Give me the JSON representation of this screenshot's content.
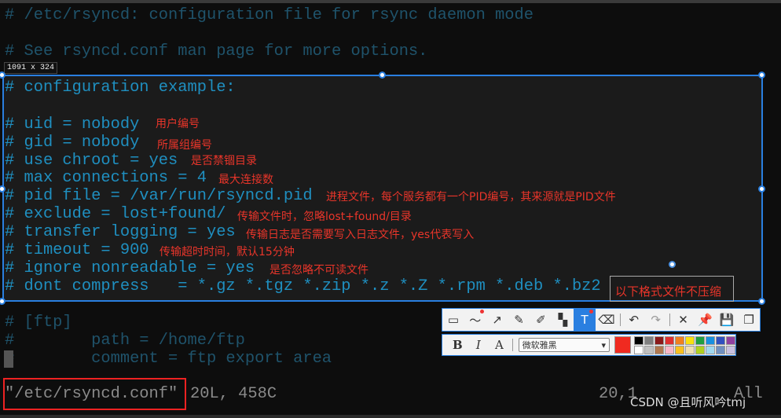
{
  "editor": {
    "header_lines": [
      "# /etc/rsyncd: configuration file for rsync daemon mode",
      "# See rsyncd.conf man page for more options."
    ],
    "selected_lines": [
      "# configuration example:",
      "# uid = nobody",
      "# gid = nobody",
      "# use chroot = yes",
      "# max connections = 4",
      "# pid file = /var/run/rsyncd.pid",
      "# exclude = lost+found/",
      "# transfer logging = yes",
      "# timeout = 900",
      "# ignore nonreadable = yes",
      "# dont compress   = *.gz *.tgz *.zip *.z *.Z *.rpm *.deb *.bz2"
    ],
    "footer_lines": [
      "# [ftp]",
      "#        path = /home/ftp",
      "#        comment = ftp export area"
    ],
    "status_file": "\"/etc/rsyncd.conf\"",
    "status_info": "20L, 458C",
    "status_pos": "20,1",
    "status_all": "All"
  },
  "annotations": [
    "用户编号",
    "所属组编号",
    "是否禁锢目录",
    "最大连接数",
    "进程文件，每个服务都有一个PID编号，其来源就是PID文件",
    "传输文件时，忽略lost+found/目录",
    "传输日志是否需要写入日志文件，yes代表写入",
    "传输超时时间，默认15分钟",
    "是否忽略不可读文件",
    "以下格式文件不压缩"
  ],
  "capture": {
    "size_label": "1091 x 324"
  },
  "toolbar": {
    "tools": [
      "rect-ellipse",
      "freehand",
      "arrow",
      "pencil",
      "marker",
      "mosaic",
      "text",
      "eraser",
      "undo",
      "redo",
      "cancel",
      "pin",
      "save",
      "copy"
    ],
    "font": "微软雅黑",
    "bold": "B",
    "italic": "I",
    "font_icon": "A",
    "text_tool": "T",
    "current_color": "#f02a20",
    "palette": [
      "#000000",
      "#808080",
      "#8b1a1a",
      "#e03030",
      "#f08020",
      "#f8e010",
      "#20a040",
      "#1890e0",
      "#3050c0",
      "#9040a0",
      "#ffffff",
      "#c0c0c0",
      "#b07850",
      "#f8b8c8",
      "#f8c020",
      "#f0e0b0",
      "#b0d020",
      "#a0d8f0",
      "#7090c0",
      "#c8c0e0"
    ]
  },
  "watermark": "CSDN @且听风吟tmj"
}
